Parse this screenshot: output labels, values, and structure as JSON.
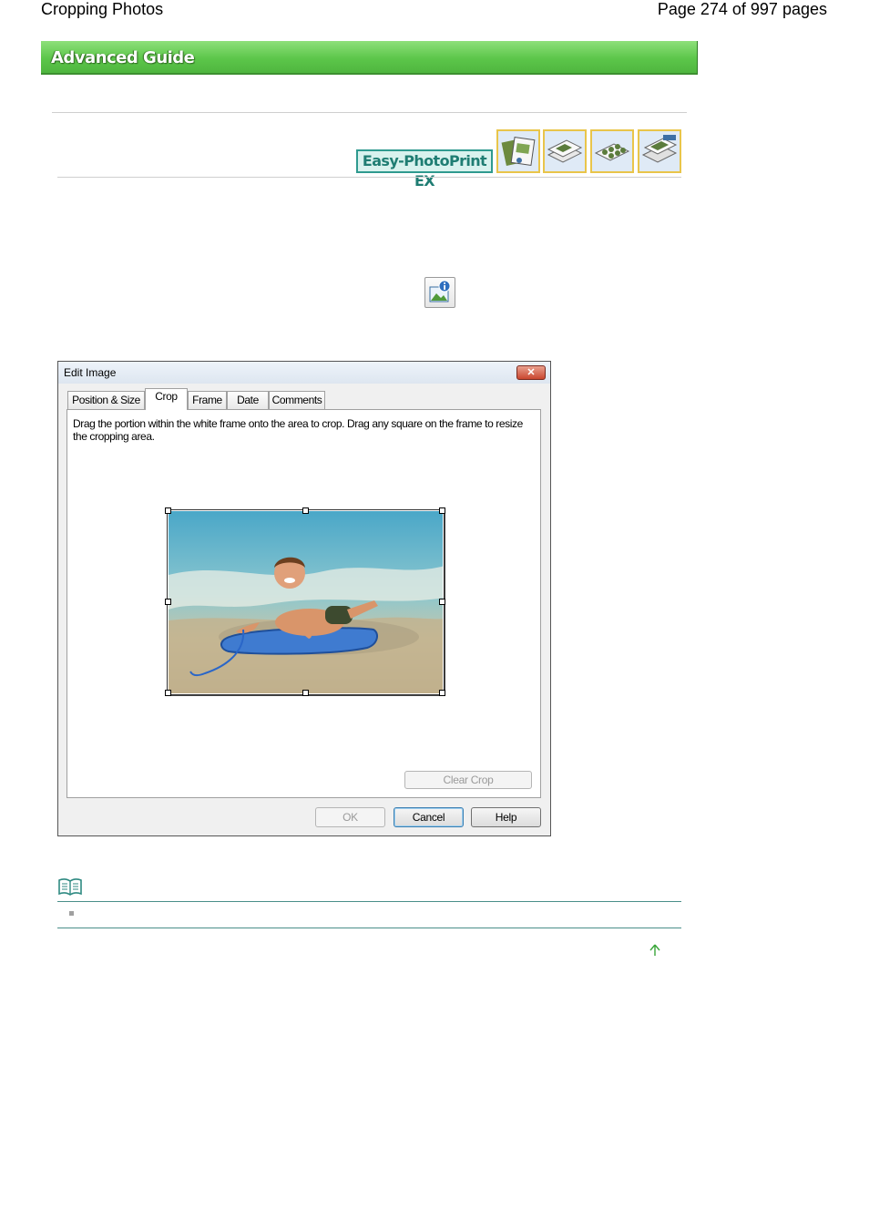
{
  "page": {
    "title": "Cropping Photos",
    "page_indicator": "Page 274 of 997 pages"
  },
  "banner": {
    "label": "Advanced Guide"
  },
  "product": {
    "badge": "Easy-PhotoPrint EX",
    "mode_icons": [
      "album-icon",
      "layout-print-icon",
      "stickers-icon",
      "calendar-icon"
    ]
  },
  "toolbar": {
    "info_icon": "image-info-icon"
  },
  "dialog": {
    "title": "Edit Image",
    "close_icon": "close-icon",
    "tabs": [
      {
        "label": "Position & Size"
      },
      {
        "label": "Crop"
      },
      {
        "label": "Frame"
      },
      {
        "label": "Date"
      },
      {
        "label": "Comments"
      }
    ],
    "active_tab": "Crop",
    "instructions": "Drag the portion within the white frame onto the area to crop. Drag any square on the frame to resize the cropping area.",
    "clear_crop_label": "Clear Crop",
    "buttons": {
      "ok": "OK",
      "cancel": "Cancel",
      "help": "Help"
    }
  },
  "note": {
    "icon": "note-book-icon"
  },
  "footer": {
    "top_link_icon": "arrow-up-icon"
  },
  "colors": {
    "banner_green": "#5cc64a",
    "badge_teal": "#2f9a8f",
    "note_rule": "#4a8f8a"
  }
}
